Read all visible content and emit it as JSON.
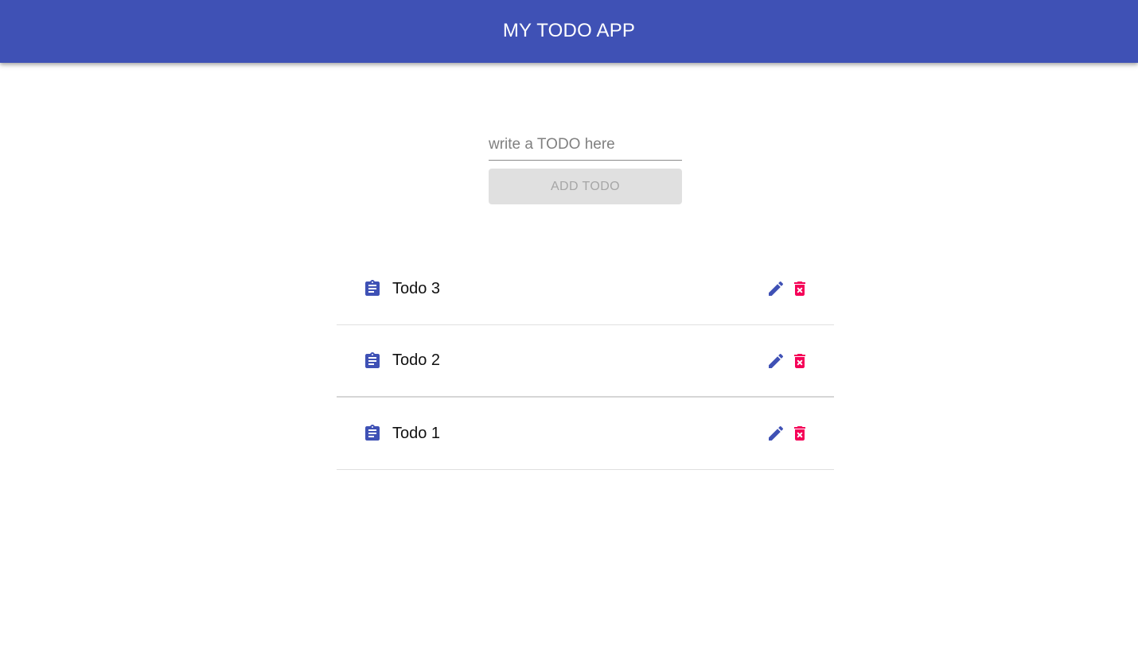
{
  "header": {
    "title": "MY TODO APP",
    "color": "#3f51b5"
  },
  "form": {
    "input_value": "",
    "input_placeholder": "write a TODO here",
    "add_button_label": "ADD TODO"
  },
  "todos": [
    {
      "text": "Todo 3",
      "icon": "assignment-icon",
      "edit_icon": "edit-icon",
      "delete_icon": "delete-forever-icon"
    },
    {
      "text": "Todo 2",
      "icon": "assignment-icon",
      "edit_icon": "edit-icon",
      "delete_icon": "delete-forever-icon"
    },
    {
      "text": "Todo 1",
      "icon": "assignment-icon",
      "edit_icon": "edit-icon",
      "delete_icon": "delete-forever-icon"
    }
  ],
  "colors": {
    "primary": "#3f51b5",
    "danger": "#f50057"
  }
}
